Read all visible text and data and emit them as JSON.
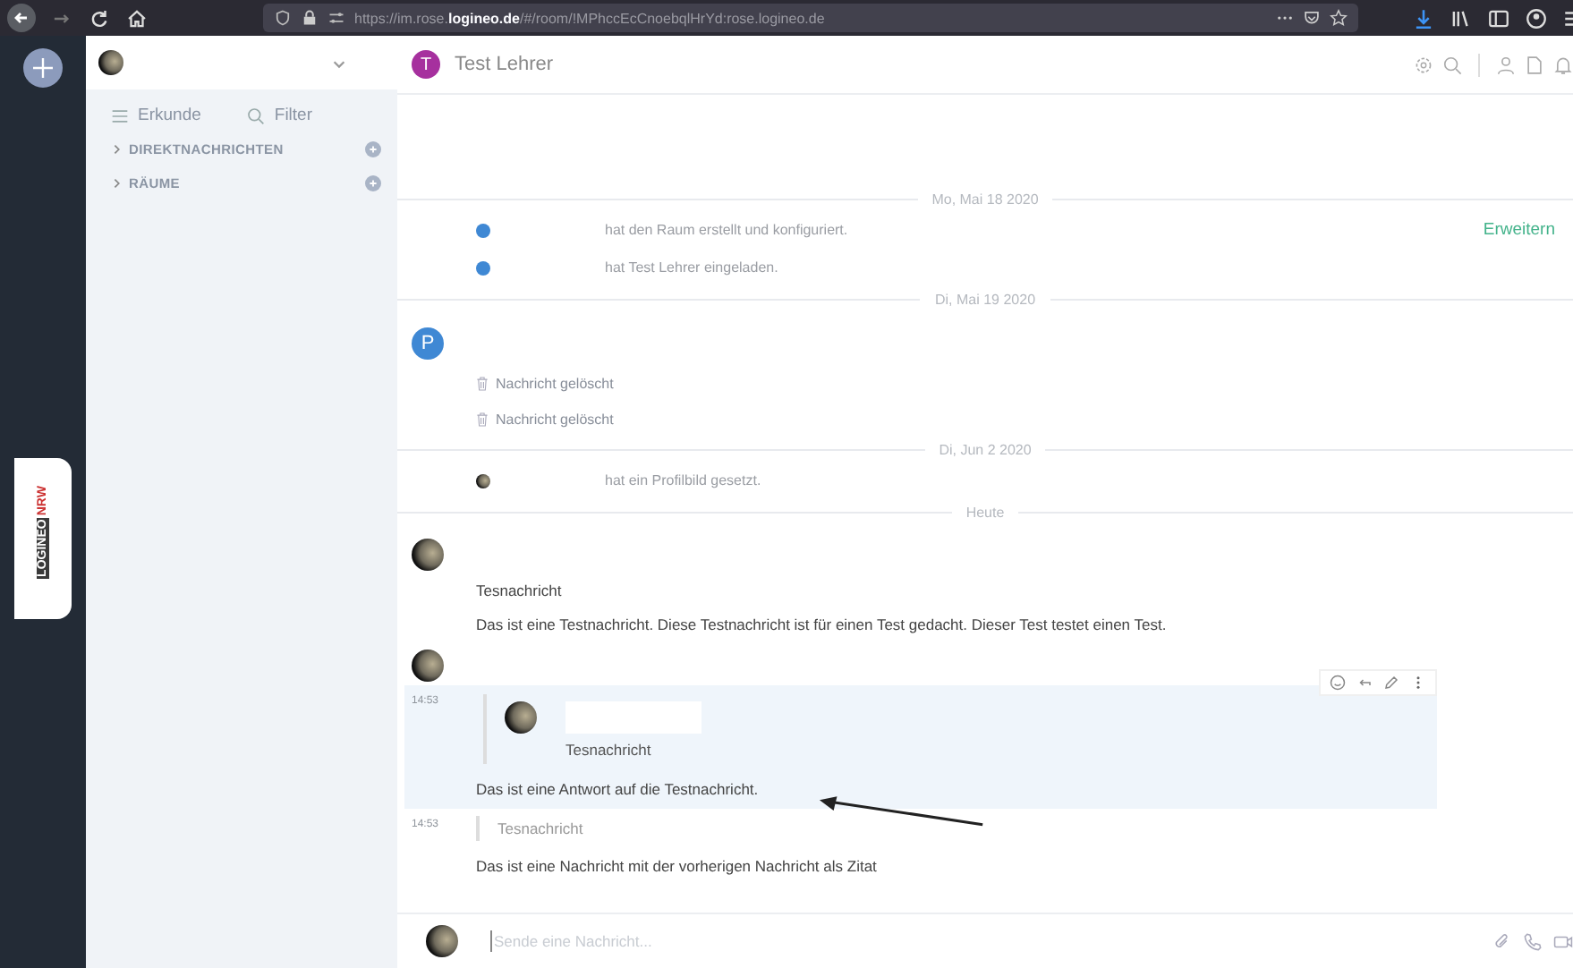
{
  "browser": {
    "url": "https://im.rose.**logineo.de**/#/room/!MPhccEcCnoebqlHrYd:rose.logineo.de"
  },
  "rail": {
    "logo_parts": [
      "LOGINEO",
      "NRW"
    ]
  },
  "sidebar": {
    "explore": "Erkunde",
    "filter": "Filter",
    "sections": [
      {
        "label": "DIREKTNACHRICHTEN"
      },
      {
        "label": "RÄUME"
      }
    ]
  },
  "room": {
    "avatar_letter": "T",
    "title": "Test Lehrer"
  },
  "timeline": [
    {
      "kind": "divider",
      "label": "Mo, Mai 18 2020"
    },
    {
      "kind": "event",
      "photo_avatar": false,
      "text": "hat den Raum erstellt und konfiguriert.",
      "action": "Erweitern"
    },
    {
      "kind": "event",
      "photo_avatar": false,
      "text": "hat Test Lehrer eingeladen."
    },
    {
      "kind": "divider",
      "label": "Di, Mai 19 2020"
    },
    {
      "kind": "sender",
      "avatar_letter": "P"
    },
    {
      "kind": "deleted",
      "text": "Nachricht gelöscht"
    },
    {
      "kind": "deleted",
      "text": "Nachricht gelöscht"
    },
    {
      "kind": "divider",
      "label": "Di, Jun 2 2020"
    },
    {
      "kind": "event",
      "photo_avatar": true,
      "text": "hat ein Profilbild gesetzt."
    },
    {
      "kind": "divider",
      "label": "Heute"
    },
    {
      "kind": "message",
      "title": "Tesnachricht",
      "body": "Das ist eine Testnachricht. Diese Testnachricht ist für einen Test gedacht. Dieser Test testet einen Test."
    },
    {
      "kind": "reply",
      "time": "14:53",
      "quote_title": "Tesnachricht",
      "body": "Das ist eine Antwort auf die Testnachricht.",
      "highlighted": true
    },
    {
      "kind": "quote",
      "time": "14:53",
      "quote_title": "Tesnachricht",
      "body": "Das ist eine Nachricht mit der vorherigen Nachricht als Zitat"
    }
  ],
  "composer": {
    "placeholder": "Sende eine Nachricht..."
  }
}
